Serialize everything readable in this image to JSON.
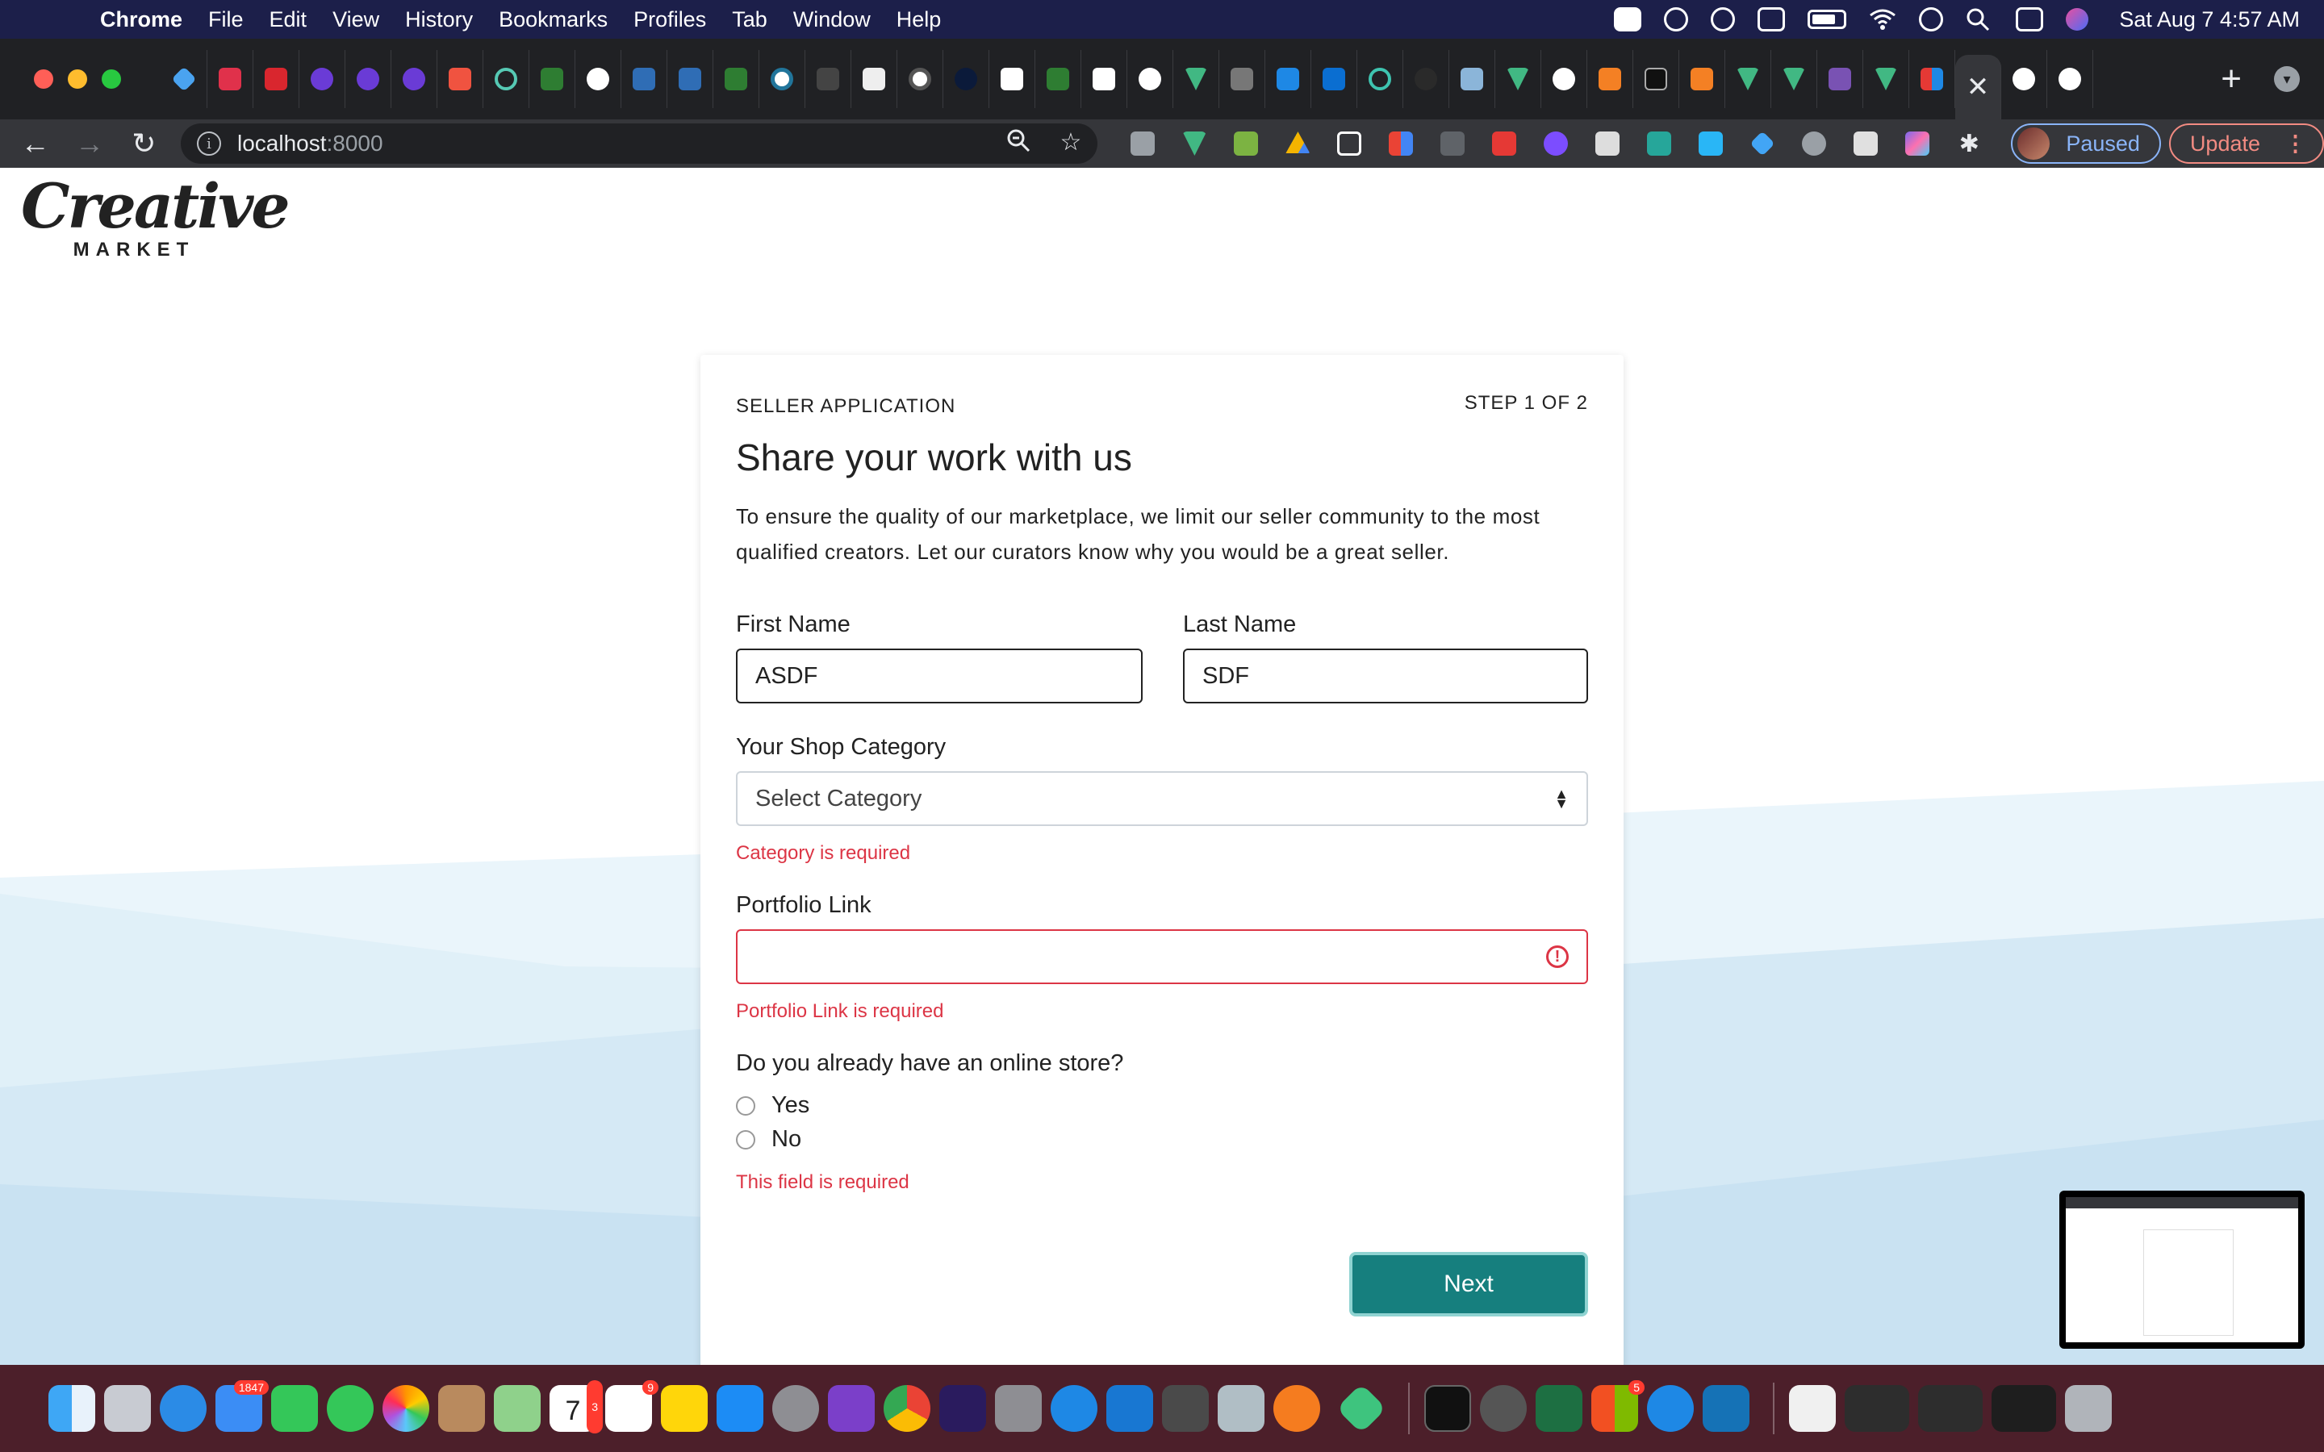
{
  "menubar": {
    "app": "Chrome",
    "items": [
      "File",
      "Edit",
      "View",
      "History",
      "Bookmarks",
      "Profiles",
      "Tab",
      "Window",
      "Help"
    ],
    "clock": "Sat Aug 7  4:57 AM"
  },
  "browser": {
    "url_host": "localhost",
    "url_port": ":8000",
    "profile_label": "Paused",
    "update_label": "Update"
  },
  "logo": {
    "word": "Creative",
    "sub": "MARKET"
  },
  "form": {
    "eyebrow": "SELLER APPLICATION",
    "step": "STEP 1 OF 2",
    "title": "Share your work with us",
    "intro": "To ensure the quality of our marketplace, we limit our seller community to the most qualified creators. Let our curators know why you would be a great seller.",
    "first_name": {
      "label": "First Name",
      "value": "ASDF"
    },
    "last_name": {
      "label": "Last Name",
      "value": "SDF"
    },
    "category": {
      "label": "Your Shop Category",
      "value": "Select Category",
      "error": "Category is required"
    },
    "portfolio": {
      "label": "Portfolio Link",
      "value": "",
      "error": "Portfolio Link is required"
    },
    "online_store": {
      "question": "Do you already have an online store?",
      "options": [
        "Yes",
        "No"
      ],
      "error": "This field is required"
    },
    "next_label": "Next"
  },
  "dock": {
    "badges": {
      "mail": "1847",
      "calendar_date": "7",
      "calendar_badge": "3",
      "reminders": "9",
      "microsoft": "5"
    }
  },
  "colors": {
    "accent": "#167f7e",
    "error": "#dc3545",
    "menubar": "#1c1f4a",
    "dock": "#4c1f2a"
  }
}
